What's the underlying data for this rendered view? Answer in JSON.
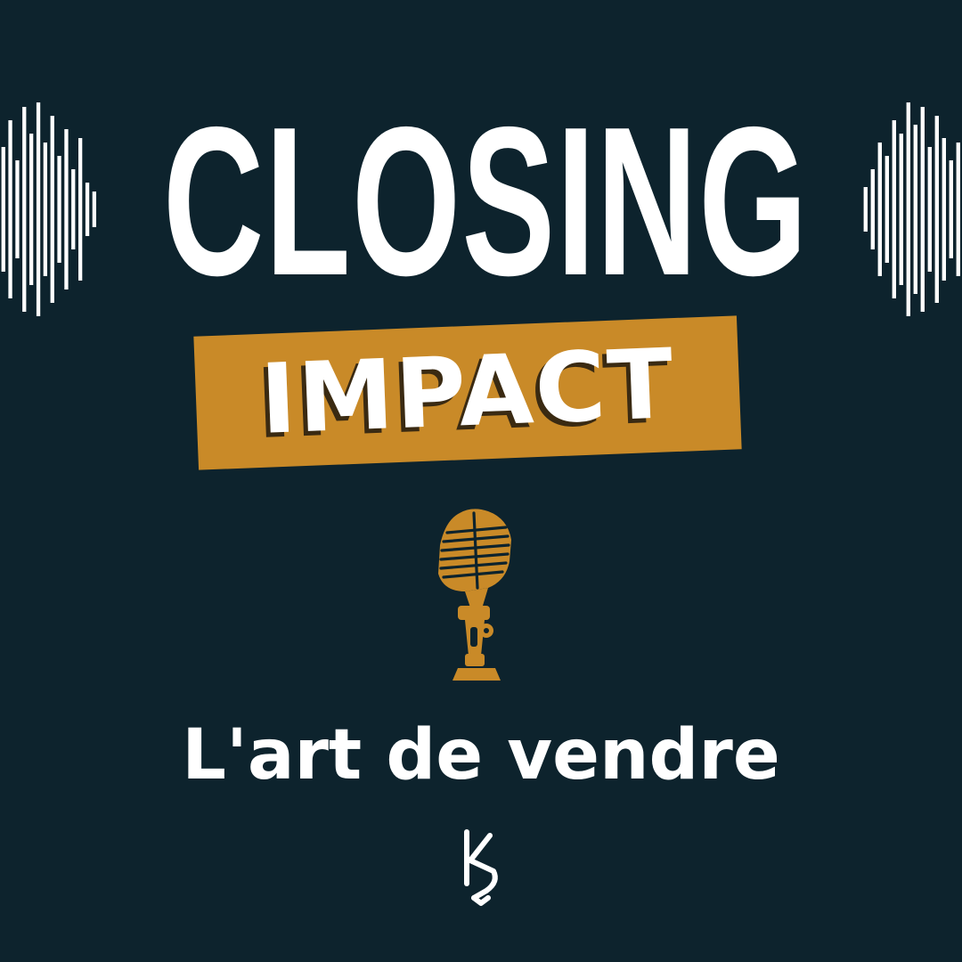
{
  "cover": {
    "title": "CLOSING",
    "banner": "IMPACT",
    "tagline": "L'art de vendre",
    "logo_text": "KS"
  },
  "colors": {
    "background": "#0d232d",
    "accent": "#c98a28",
    "text": "#ffffff"
  },
  "icons": {
    "left_wave": "sound-wave-icon",
    "right_wave": "sound-wave-icon",
    "microphone": "microphone-icon",
    "logo": "ks-monogram-logo"
  }
}
